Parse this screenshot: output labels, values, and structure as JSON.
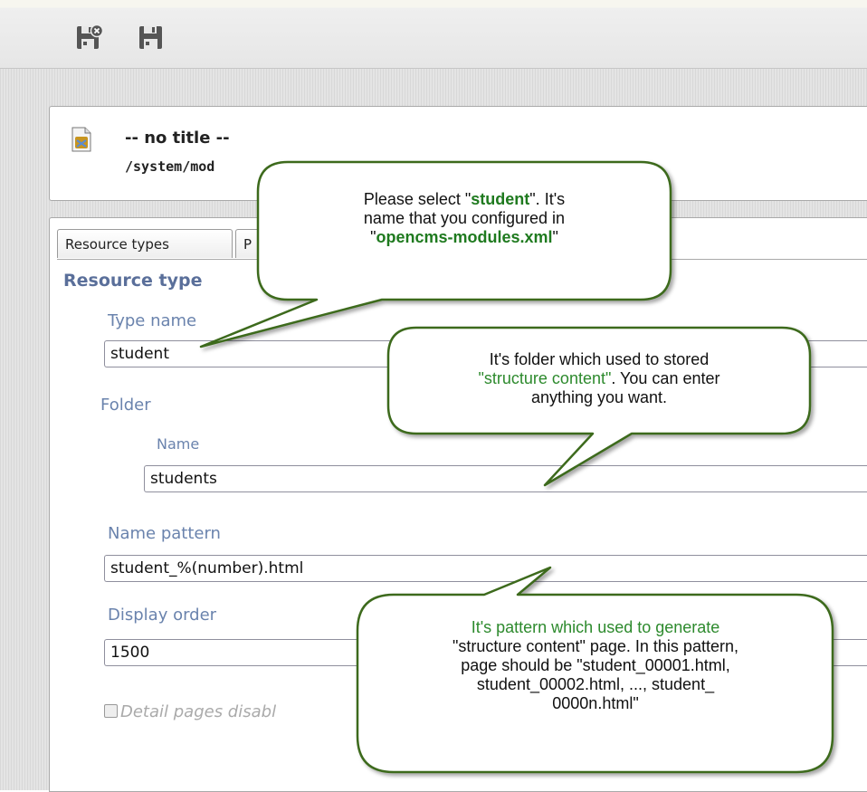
{
  "toolbar": {
    "icons": [
      "save-exit-icon",
      "save-icon"
    ]
  },
  "resource": {
    "title": "-- no title --",
    "path": "/system/mod"
  },
  "tabs": [
    {
      "label": "Resource types"
    },
    {
      "label": "P"
    }
  ],
  "form": {
    "section_title": "Resource type",
    "type_name": {
      "label": "Type name",
      "value": "student"
    },
    "folder": {
      "label": "Folder",
      "name_label": "Name",
      "name_value": "students"
    },
    "name_pattern": {
      "label": "Name pattern",
      "value": "student_%(number).html"
    },
    "display_order": {
      "label": "Display order",
      "value": "1500"
    },
    "detail_pages": {
      "label": "Detail pages disabl",
      "checked": false
    }
  },
  "callouts": {
    "c1": {
      "line1_pre": "Please select \"",
      "line1_bold": "student",
      "line1_post": "\". It's",
      "line2": "name that you configured in",
      "line3_pre": "\"",
      "line3_bold": "opencms-modules.xml",
      "line3_post": "\""
    },
    "c2": {
      "line1": "It's folder which used to stored",
      "line2_green": "\"structure content\"",
      "line2_rest": ". You can enter",
      "line3": "anything you want."
    },
    "c3": {
      "line1": "It's pattern which used to generate",
      "line2": "\"structure content\" page. In this pattern,",
      "line3": "page should be \"student_00001.html,",
      "line4": "student_00002.html, ..., student_",
      "line5": "0000n.html\""
    }
  },
  "colors": {
    "callout_fill": "#ffffff",
    "callout_border": "#3c6a1e",
    "label_blue": "#6a83ad",
    "highlight_green": "#1f7a1f"
  }
}
